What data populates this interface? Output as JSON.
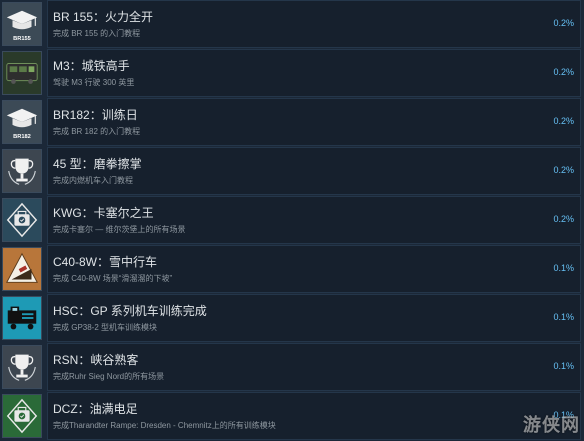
{
  "achievements": [
    {
      "title": "BR 155：火力全开",
      "desc": "完成 BR 155 的入门教程",
      "percent": "0.2%",
      "icon": "graduation-cap-icon",
      "icon_text": "BR155",
      "icon_bg": "#3c4a56"
    },
    {
      "title": "M3：城铁高手",
      "desc": "驾驶 M3 行驶 300 英里",
      "percent": "0.2%",
      "icon": "train-icon",
      "icon_text": "",
      "icon_bg": "#2f4a2c"
    },
    {
      "title": "BR182：训练日",
      "desc": "完成 BR 182 的入门教程",
      "percent": "0.2%",
      "icon": "graduation-cap-icon",
      "icon_text": "BR182",
      "icon_bg": "#3c4a56"
    },
    {
      "title": "45 型：磨拳擦掌",
      "desc": "完成内燃机车入门教程",
      "percent": "0.2%",
      "icon": "trophy-icon",
      "icon_text": "",
      "icon_bg": "#3d4650"
    },
    {
      "title": "KWG：卡塞尔之王",
      "desc": "完成卡塞尔 — 维尔茨堡上的所有场景",
      "percent": "0.2%",
      "icon": "checked-briefcase-icon",
      "icon_text": "",
      "icon_bg": "#2b4a5c"
    },
    {
      "title": "C40-8W：雪中行车",
      "desc": "完成 C40-8W 场景“滑溜溜的下坡”",
      "percent": "0.1%",
      "icon": "warning-slope-icon",
      "icon_text": "",
      "icon_bg": "#a86a30"
    },
    {
      "title": "HSC：GP 系列机车训练完成",
      "desc": "完成 GP38-2 型机车训练模块",
      "percent": "0.1%",
      "icon": "locomotive-icon",
      "icon_text": "",
      "icon_bg": "#1e8fa8"
    },
    {
      "title": "RSN：峡谷熟客",
      "desc": "完成Ruhr Sieg Nord的所有场景",
      "percent": "0.1%",
      "icon": "trophy-icon",
      "icon_text": "",
      "icon_bg": "#3d4650"
    },
    {
      "title": "DCZ：油满电足",
      "desc": "完成Tharandter Rampe: Dresden - Chemnitz上的所有训练模块",
      "percent": "0.1%",
      "icon": "checked-briefcase-icon",
      "icon_text": "",
      "icon_bg": "#2a6a38"
    }
  ],
  "watermark": "游侠网"
}
